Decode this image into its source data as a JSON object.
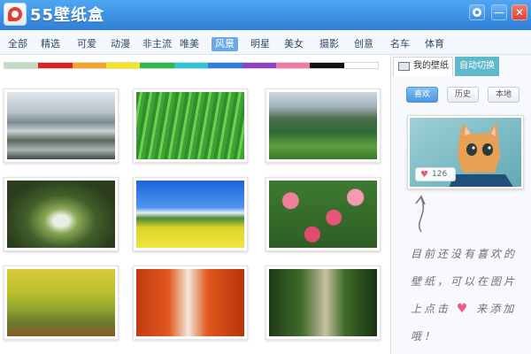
{
  "app": {
    "title": "55壁纸盒"
  },
  "window_controls": {
    "settings_icon": "gear-icon",
    "minimize_label": "—",
    "close_label": "✕"
  },
  "categories": [
    "全部",
    "精选",
    "可爱",
    "动漫",
    "非主流",
    "唯美",
    "风景",
    "明星",
    "美女",
    "摄影",
    "创意",
    "名车",
    "体育"
  ],
  "active_category": "风景",
  "color_filters": [
    "#c2dcc2",
    "#e02020",
    "#f5a623",
    "#f7e61c",
    "#2fb84a",
    "#29c5d8",
    "#2f7de0",
    "#8e44c0",
    "#f07aa8",
    "#111111",
    "#ffffff"
  ],
  "wallpapers": [
    {
      "name": "rice-terraces"
    },
    {
      "name": "green-grass"
    },
    {
      "name": "mountain-valley"
    },
    {
      "name": "tree-tunnel-house"
    },
    {
      "name": "rapeseed-field"
    },
    {
      "name": "red-flowers"
    },
    {
      "name": "autumn-trees"
    },
    {
      "name": "red-maple-avenue"
    },
    {
      "name": "forest-boardwalk"
    }
  ],
  "panel": {
    "tab_mine": "我的壁纸",
    "tab_auto": "自动切换",
    "sub_tabs": [
      "喜欢",
      "历史",
      "本地"
    ],
    "like_count": "126",
    "hint_text": "目前还没有喜欢的壁纸，可以在图片上点击",
    "hint_tail": "来添加哦！"
  }
}
